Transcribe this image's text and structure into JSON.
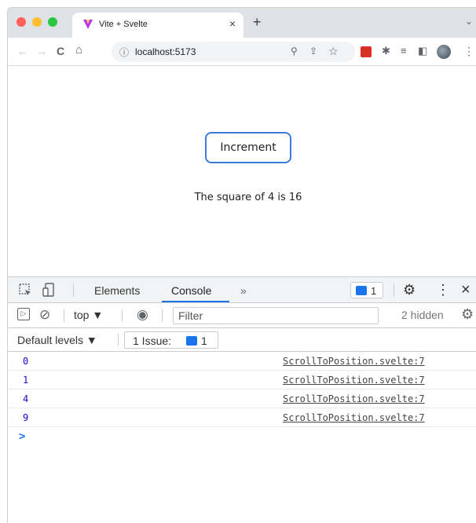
{
  "browser": {
    "tab_title": "Vite + Svelte",
    "tab_close": "×",
    "new_tab": "+",
    "tab_menu": "⌄",
    "url": "localhost:5173",
    "nav": {
      "back": "←",
      "forward": "→",
      "reload": "C",
      "home": "⌂"
    },
    "info_icon": "ⓘ",
    "omnibox_icons": [
      "zoom-icon",
      "share-icon",
      "bookmark-star-icon"
    ],
    "extensions": [
      "red-extension-icon",
      "puzzle-icon",
      "reading-list-icon",
      "side-panel-icon",
      "profile-avatar-icon",
      "kebab-menu-icon"
    ],
    "glyphs": {
      "zoom": "⚲",
      "share": "⇪",
      "star": "☆",
      "puzzle": "✱",
      "reading": "≡",
      "panel": "◧",
      "menu": "⋮"
    }
  },
  "page": {
    "button_label": "Increment",
    "result_text": "The square of 4 is 16"
  },
  "devtools": {
    "tabs": {
      "elements": "Elements",
      "console": "Console",
      "more": "»"
    },
    "issue_count": "1",
    "gear": "⚙",
    "kebab": "⋮",
    "close": "×",
    "context": "top ▼",
    "filter_placeholder": "Filter",
    "hidden": "2 hidden",
    "default_levels": "Default levels ▼",
    "issues_label": "1 Issue:",
    "issues_count": "1",
    "eye": "◉",
    "block": "⊘",
    "sidebar": "▷",
    "logs": [
      {
        "value": "0",
        "source": "ScrollToPosition.svelte:7"
      },
      {
        "value": "1",
        "source": "ScrollToPosition.svelte:7"
      },
      {
        "value": "4",
        "source": "ScrollToPosition.svelte:7"
      },
      {
        "value": "9",
        "source": "ScrollToPosition.svelte:7"
      }
    ],
    "prompt": ">"
  },
  "colors": {
    "accent": "#1a73e8",
    "button_border": "#3b7ed8",
    "log_value": "#1c00cf"
  }
}
